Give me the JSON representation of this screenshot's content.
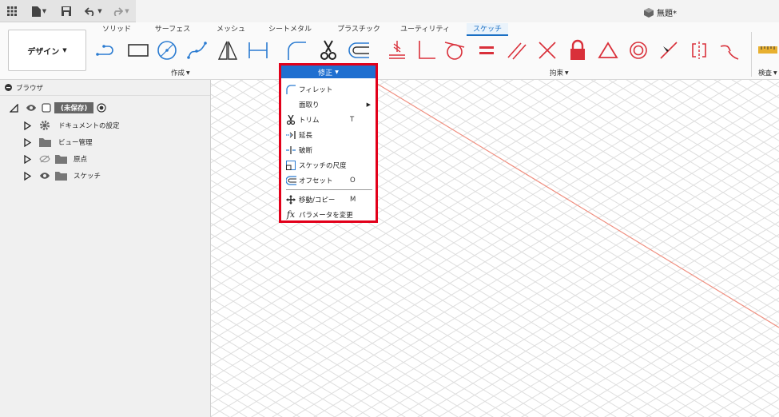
{
  "doc_title": "無題*",
  "tabs": [
    "ソリッド",
    "サーフェス",
    "メッシュ",
    "シートメタル",
    "プラスチック",
    "ユーティリティ",
    "スケッチ"
  ],
  "active_tab": "スケッチ",
  "workspace_label": "デザイン",
  "groups": {
    "create": "作成",
    "constraint": "拘束",
    "inspect": "検査"
  },
  "browser": {
    "title": "ブラウザ",
    "root": "(未保存)",
    "items": [
      "ドキュメントの設定",
      "ビュー管理",
      "原点",
      "スケッチ"
    ]
  },
  "menu": {
    "title": "修正",
    "items": [
      {
        "label": "フィレット",
        "shortcut": ""
      },
      {
        "label": "面取り",
        "shortcut": ""
      },
      {
        "label": "トリム",
        "shortcut": "T"
      },
      {
        "label": "延長",
        "shortcut": ""
      },
      {
        "label": "破断",
        "shortcut": ""
      },
      {
        "label": "スケッチの尺度",
        "shortcut": ""
      },
      {
        "label": "オフセット",
        "shortcut": "O"
      },
      {
        "label": "移動/コピー",
        "shortcut": "M"
      },
      {
        "label": "パラメータを変更",
        "shortcut": ""
      }
    ]
  },
  "colors": {
    "accent": "#1f6fd0",
    "highlight": "#e2001a",
    "constraint_red": "#d9303a",
    "sketch_blue": "#2a7bd1"
  }
}
